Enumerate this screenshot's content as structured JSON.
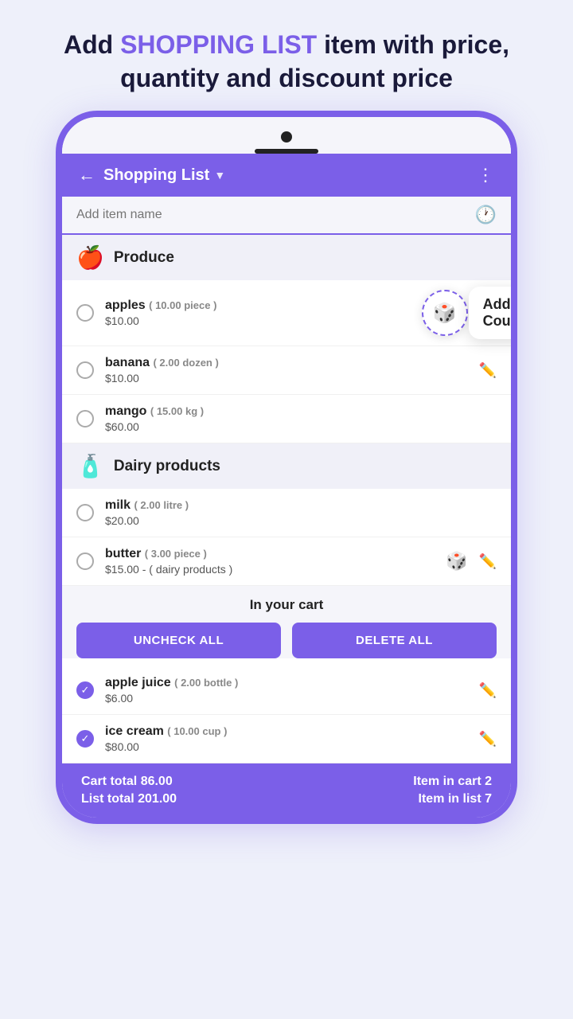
{
  "header": {
    "line1_prefix": "Add ",
    "line1_highlight": "SHOPPING LIST",
    "line1_suffix": " item with price,",
    "line2": "quantity and discount price"
  },
  "appbar": {
    "title": "Shopping List",
    "back_icon": "←",
    "chevron": "▼",
    "more_icon": "⋮"
  },
  "add_item": {
    "placeholder": "Add item name",
    "clock_icon": "🕐"
  },
  "sections": [
    {
      "id": "produce",
      "icon": "🍎",
      "title": "Produce",
      "items": [
        {
          "name": "apples",
          "meta": "( 10.00 piece )",
          "price": "$10.00",
          "checked": false,
          "has_coupon": true,
          "has_edit": true
        },
        {
          "name": "banana",
          "meta": "( 2.00 dozen )",
          "price": "$10.00",
          "checked": false,
          "has_coupon": false,
          "has_edit": true
        },
        {
          "name": "mango",
          "meta": "( 15.00 kg )",
          "price": "$60.00",
          "checked": false,
          "has_coupon": false,
          "has_edit": false
        }
      ]
    },
    {
      "id": "dairy",
      "icon": "🧴",
      "title": "Dairy products",
      "items": [
        {
          "name": "milk",
          "meta": "( 2.00 litre )",
          "price": "$20.00",
          "checked": false,
          "has_coupon": false,
          "has_edit": false
        },
        {
          "name": "butter",
          "meta": "( 3.00 piece )",
          "price": "$15.00 - ( dairy products )",
          "checked": false,
          "has_coupon": true,
          "has_edit": true
        }
      ]
    }
  ],
  "cart": {
    "title": "In your cart",
    "uncheck_all": "UNCHECK ALL",
    "delete_all": "DELETE ALL",
    "items": [
      {
        "name": "apple juice",
        "meta": "( 2.00 bottle )",
        "price": "$6.00",
        "checked": true,
        "has_edit": true
      },
      {
        "name": "ice cream",
        "meta": "( 10.00 cup )",
        "price": "$80.00",
        "checked": true,
        "has_edit": true
      }
    ]
  },
  "offer_coupon": {
    "label": "Add Offer\nCoupon",
    "dice_emoji": "🎲"
  },
  "bottom_bar": {
    "cart_total_label": "Cart total",
    "cart_total_value": "86.00",
    "list_total_label": "List total",
    "list_total_value": "201.00",
    "item_in_cart_label": "Item in cart",
    "item_in_cart_value": "2",
    "item_in_list_label": "Item in list",
    "item_in_list_value": "7"
  }
}
